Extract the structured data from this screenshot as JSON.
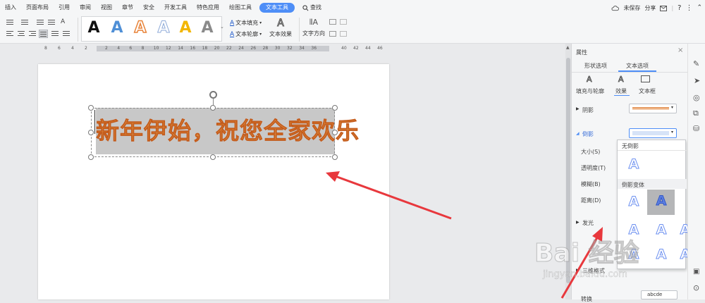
{
  "menubar": {
    "items": [
      "插入",
      "页面布局",
      "引用",
      "审阅",
      "视图",
      "章节",
      "安全",
      "开发工具",
      "特色应用",
      "绘图工具",
      "文本工具"
    ],
    "active_index": 10,
    "search_label": "查找",
    "unsaved_label": "未保存",
    "share_label": "分享"
  },
  "ribbon": {
    "text_fill_label": "文本填充",
    "text_outline_label": "文本轮廓",
    "text_effect_label": "文本效果",
    "text_direction_label": "文字方向",
    "font_size_label": "A",
    "style_letter": "A",
    "style_colors": [
      "#111111",
      "#4f8fd6",
      "#e8843a",
      "#b9cbe8",
      "#f2b600",
      "#888888"
    ]
  },
  "ruler": {
    "left_ticks": [
      "8",
      "6",
      "4",
      "2"
    ],
    "main_ticks": [
      "2",
      "4",
      "6",
      "8",
      "10",
      "12",
      "14",
      "16",
      "18",
      "20",
      "22",
      "24",
      "26",
      "28",
      "30",
      "32",
      "34",
      "36"
    ],
    "right_ticks": [
      "40",
      "42",
      "44",
      "46"
    ]
  },
  "document": {
    "textbox_text": "新年伊始，祝您全家欢乐",
    "text_color": "#d9893f",
    "box_fill": "#c8c8c8"
  },
  "panel": {
    "title": "属性",
    "tabs": [
      "形状选项",
      "文本选项"
    ],
    "active_tab": 1,
    "subtabs": [
      "填充与轮廓",
      "效果",
      "文本框"
    ],
    "active_subtab": 1,
    "shadow_label": "阴影",
    "reflection_label": "倒影",
    "size_label": "大小(S)",
    "transparency_label": "透明度(T)",
    "blur_label": "模糊(B)",
    "distance_label": "距离(D)",
    "glow_label": "发光",
    "threed_format_label": "三维格式",
    "rotate_label": "转换",
    "rotate_value": "abcde"
  },
  "dropdown": {
    "no_reflection_label": "无倒影",
    "variants_label": "倒影变体",
    "letter": "A"
  },
  "colors": {
    "accent": "#4e8ef7",
    "arrow": "#e8383d"
  },
  "watermark": {
    "brand": "Bai 经验",
    "url": "jingyan.baidu.com"
  },
  "rightbar_icons": [
    "pen-icon",
    "cursor-icon",
    "location-icon",
    "shapes-icon",
    "fill-icon",
    "image-icon",
    "settings-icon"
  ]
}
